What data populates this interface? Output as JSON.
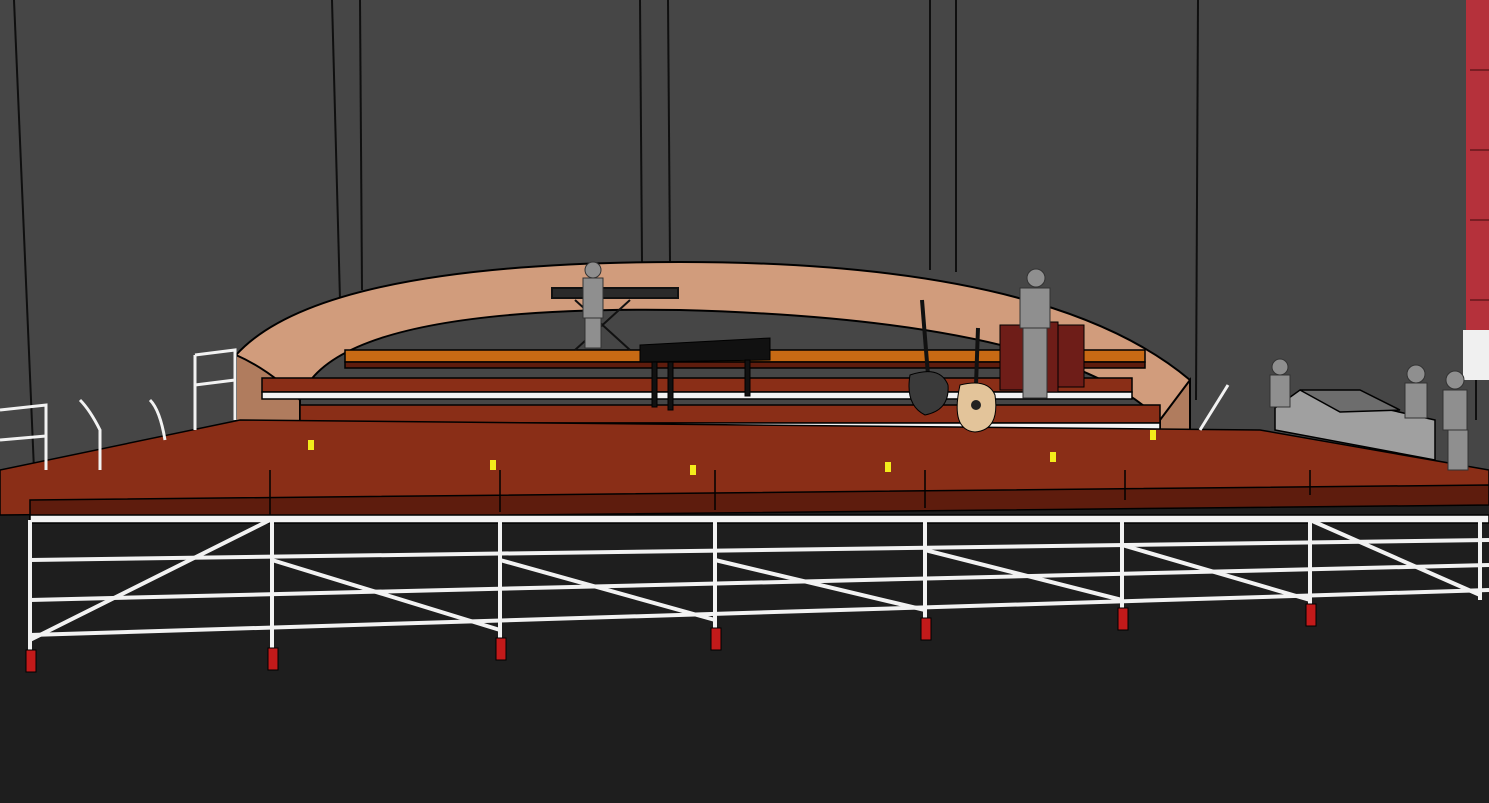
{
  "scene": {
    "kind": "3d-model-viewport",
    "subject": "stage-platform-model"
  },
  "colors": {
    "wall": "#464646",
    "wall_seam": "#0f0f0f",
    "floor": "#1e1e1e",
    "deck_top": "#8a2e17",
    "deck_dark": "#5e1c0d",
    "deck_orange": "#c86a14",
    "shell": "#d19c7c",
    "shell_shade": "#b07c5e",
    "truss": "#f2f2f2",
    "clamp_yellow": "#f3ec1b",
    "caster_red": "#c21a1a",
    "figure": "#8f8f8f",
    "piano": "#111111",
    "congas": "#6e1d18",
    "acoustic_guitar": "#e3c49a",
    "curtain_red": "#b5313b"
  },
  "icons": {
    "keyboard": "keyboard-stand-icon",
    "piano": "grand-piano-icon",
    "electric_guitar": "electric-guitar-icon",
    "acoustic_guitar": "acoustic-guitar-icon",
    "drums": "conga-drums-icon",
    "person": "person-figure-icon"
  }
}
